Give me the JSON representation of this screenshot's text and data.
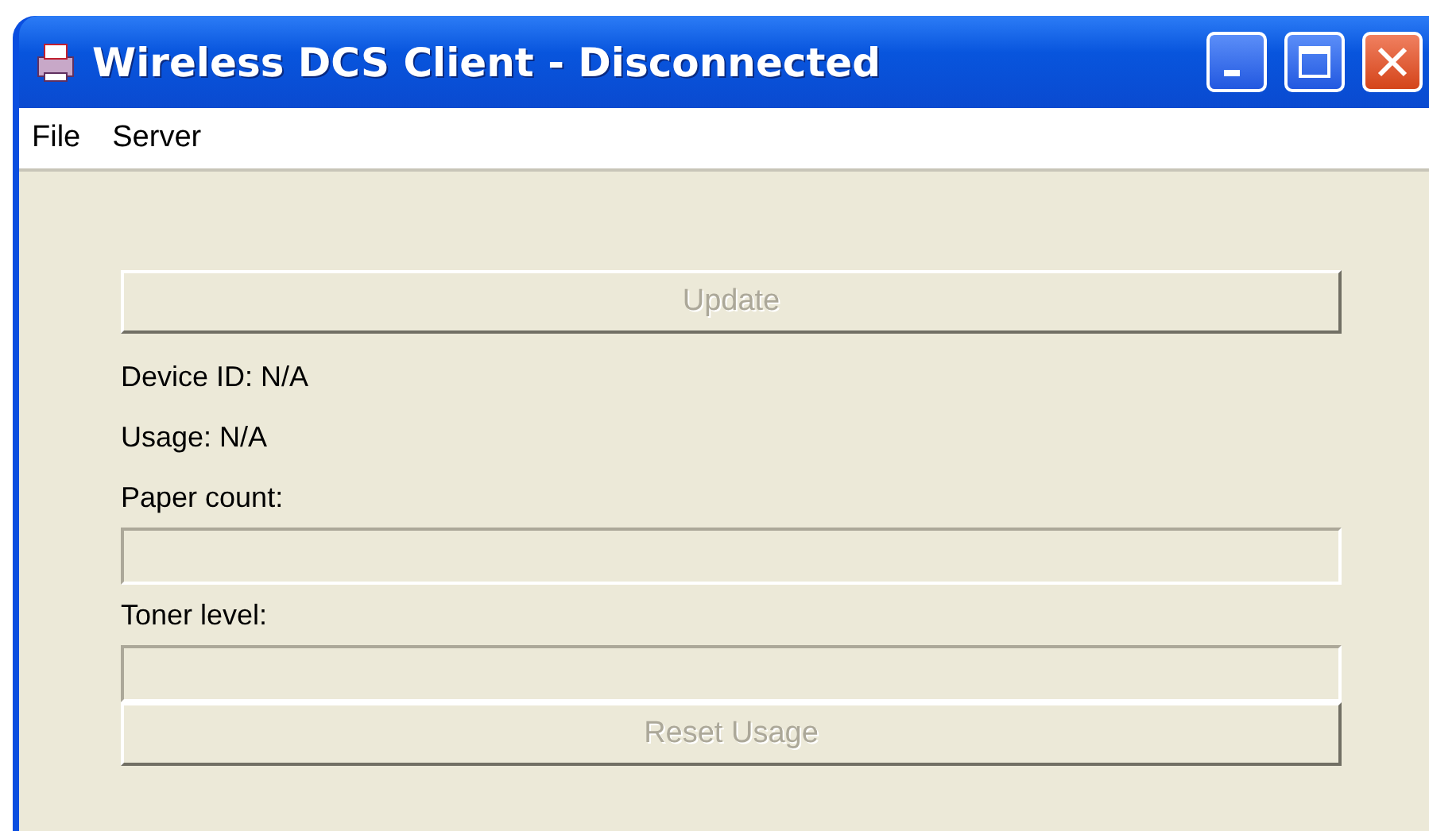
{
  "window": {
    "title": "Wireless DCS Client - Disconnected"
  },
  "menu": [
    "File",
    "Server"
  ],
  "update_button": {
    "label": "Update",
    "disabled": true
  },
  "info": [
    "Device ID: N/A",
    "Usage: N/A"
  ],
  "meters": [
    {
      "label": "Paper count:",
      "level": 0
    },
    {
      "label": "Toner level:",
      "level": 0
    }
  ],
  "reset_button": {
    "label": "Reset Usage",
    "disabled": true
  }
}
